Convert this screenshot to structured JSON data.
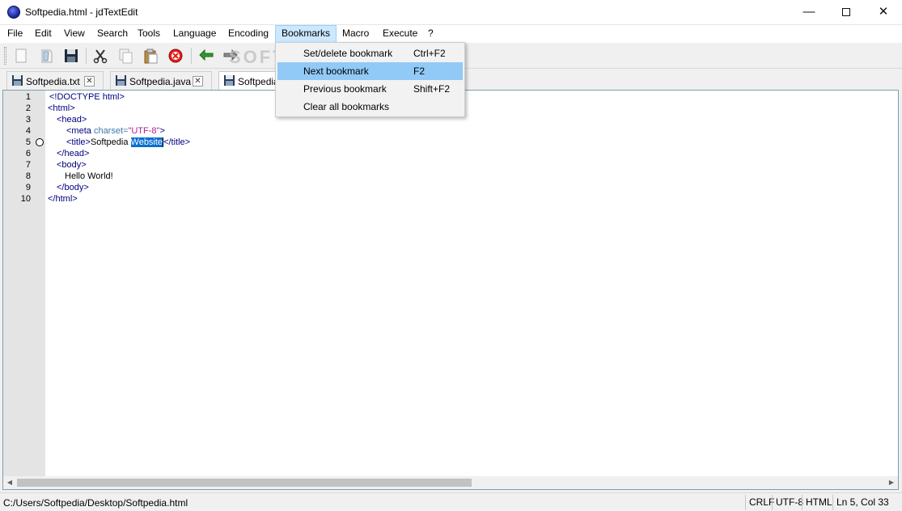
{
  "window": {
    "title": "Softpedia.html - jdTextEdit"
  },
  "menu": {
    "items": [
      {
        "id": "file",
        "label": "File"
      },
      {
        "id": "edit",
        "label": "Edit"
      },
      {
        "id": "view",
        "label": "View"
      },
      {
        "id": "search",
        "label": "Search"
      },
      {
        "id": "tools",
        "label": "Tools"
      },
      {
        "id": "language",
        "label": "Language"
      },
      {
        "id": "encoding",
        "label": "Encoding"
      },
      {
        "id": "bookmarks",
        "label": "Bookmarks"
      },
      {
        "id": "macro",
        "label": "Macro"
      },
      {
        "id": "execute",
        "label": "Execute"
      },
      {
        "id": "help",
        "label": "?"
      }
    ]
  },
  "bookmarks_menu": {
    "items": [
      {
        "label": "Set/delete bookmark",
        "shortcut": "Ctrl+F2"
      },
      {
        "label": "Next bookmark",
        "shortcut": "F2"
      },
      {
        "label": "Previous bookmark",
        "shortcut": "Shift+F2"
      },
      {
        "label": "Clear all bookmarks",
        "shortcut": ""
      }
    ]
  },
  "toolbar": {
    "buttons": [
      "new-file-icon",
      "open-file-icon",
      "save-icon",
      "cut-icon",
      "copy-icon",
      "paste-icon",
      "delete-icon",
      "undo-icon",
      "redo-icon"
    ],
    "watermark": "SOFTPEDIA"
  },
  "tabs": [
    {
      "label": "Softpedia.txt"
    },
    {
      "label": "Softpedia.java"
    },
    {
      "label": "Softpedia"
    }
  ],
  "editor": {
    "line_numbers": [
      "1",
      "2",
      "3",
      "4",
      "5",
      "6",
      "7",
      "8",
      "9",
      "10"
    ],
    "bookmarked_line": 5,
    "code": {
      "l1": "<!DOCTYPE html>",
      "l2": "<html>",
      "l3": "<head>",
      "l4_tag_open": "<meta",
      "l4_attr": " charset=",
      "l4_value": "\"UTF-8\"",
      "l4_tag_close": ">",
      "l5_open": "<title>",
      "l5_text": "Softpedia ",
      "l5_selected": "Website",
      "l5_close": "</title>",
      "l6": "</head>",
      "l7": "<body>",
      "l8": "Hello World!",
      "l9": "</body>",
      "l10": "</html>"
    }
  },
  "status": {
    "path": "C:/Users/Softpedia/Desktop/Softpedia.html",
    "line_ending": "CRLF",
    "encoding": "UTF-8",
    "language": "HTML",
    "position": "Ln 5, Col 33"
  }
}
